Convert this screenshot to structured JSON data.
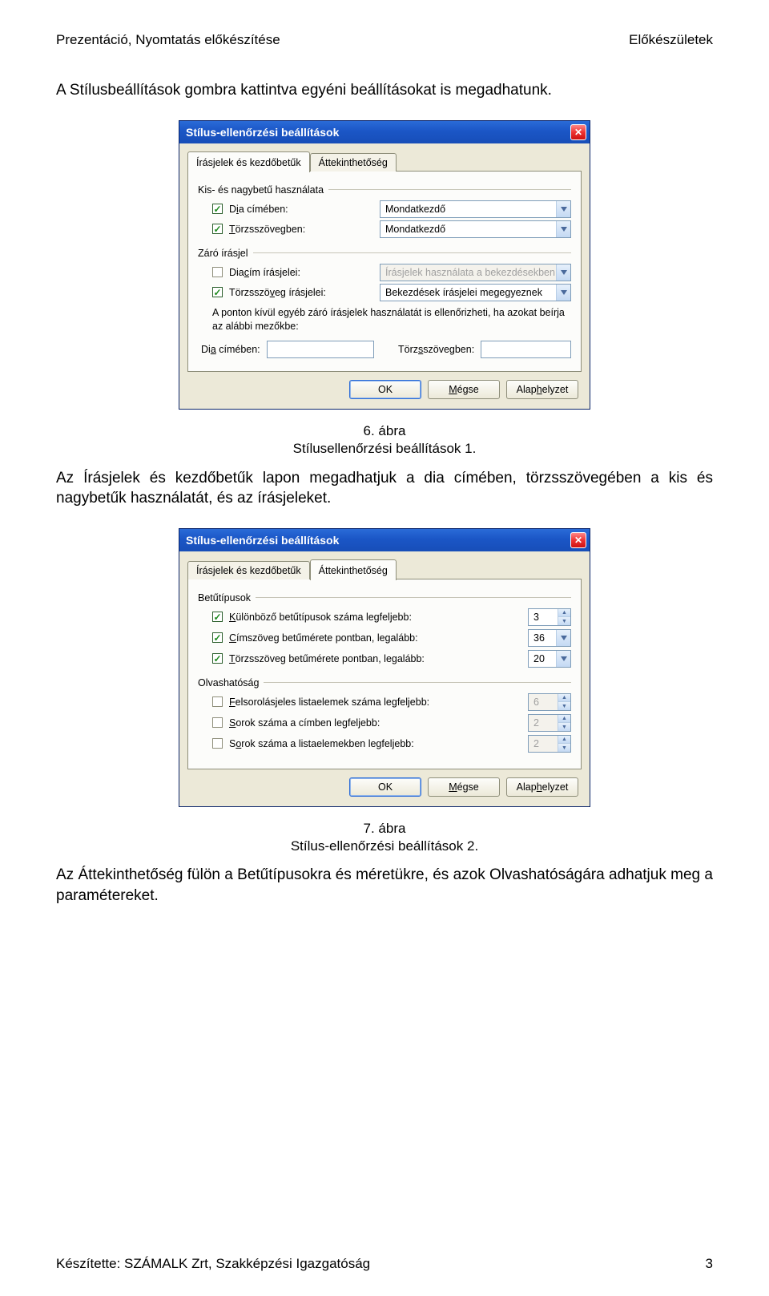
{
  "header": {
    "left": "Prezentáció, Nyomtatás előkészítése",
    "right": "Előkészületek"
  },
  "intro": "A Stílusbeállítások gombra kattintva egyéni beállításokat is megadhatunk.",
  "caption1a": "6. ábra",
  "caption1b": "Stílusellenőrzési beállítások 1.",
  "mid_para": "Az Írásjelek és kezdőbetűk lapon megadhatjuk a dia címében, törzsszövegében a kis és nagybetűk használatát, és az írásjeleket.",
  "caption2a": "7. ábra",
  "caption2b": "Stílus-ellenőrzési beállítások 2.",
  "end_para": "Az Áttekinthetőség fülön a Betűtípusokra és méretükre, és azok Olvashatóságára adhatjuk meg a paramétereket.",
  "footer": {
    "left": "Készítette: SZÁMALK Zrt, Szakképzési Igazgatóság",
    "right": "3"
  },
  "dlg1": {
    "title": "Stílus-ellenőrzési beállítások",
    "tab_active": "Írásjelek és kezdőbetűk",
    "tab_other": "Áttekinthetőség",
    "group1": "Kis- és nagybetű használata",
    "chk_diacim_pre": "D",
    "chk_diacim_ul": "i",
    "chk_diacim_post": "a címében:",
    "chk_torzs_pre": "",
    "chk_torzs_ul": "T",
    "chk_torzs_post": "örzsszövegben:",
    "dd1": "Mondatkezdő",
    "dd2": "Mondatkezdő",
    "group2": "Záró írásjel",
    "chk_diacimiras_pre": "Dia",
    "chk_diacimiras_ul": "c",
    "chk_diacimiras_post": "ím írásjelei:",
    "chk_torzsiras_pre": "Törzsszö",
    "chk_torzsiras_ul": "v",
    "chk_torzsiras_post": "eg írásjelei:",
    "dd3": "Írásjelek használata a bekezdésekben",
    "dd4": "Bekezdések írásjelei megegyeznek",
    "note": "A ponton kívül egyéb záró írásjelek használatát is ellenőrizheti, ha azokat beírja az alábbi mezőkbe:",
    "lbl_diacimeben_pre": "Di",
    "lbl_diacimeben_ul": "a",
    "lbl_diacimeben_post": " címében:",
    "lbl_torzsszov_pre": "Törz",
    "lbl_torzsszov_ul": "s",
    "lbl_torzsszov_post": "szövegben:",
    "btn_ok": "OK",
    "btn_cancel_pre": "",
    "btn_cancel_ul": "M",
    "btn_cancel_post": "égse",
    "btn_reset_pre": "Alap",
    "btn_reset_ul": "h",
    "btn_reset_post": "elyzet"
  },
  "dlg2": {
    "title": "Stílus-ellenőrzési beállítások",
    "tab_other": "Írásjelek és kezdőbetűk",
    "tab_active": "Áttekinthetőség",
    "group1": "Betűtípusok",
    "r1_pre": "",
    "r1_ul": "K",
    "r1_post": "ülönböző betűtípusok száma legfeljebb:",
    "r2_pre": "",
    "r2_ul": "C",
    "r2_post": "ímszöveg betűmérete pontban, legalább:",
    "r3_pre": "",
    "r3_ul": "T",
    "r3_post": "örzsszöveg betűmérete pontban, legalább:",
    "v1": "3",
    "v2": "36",
    "v3": "20",
    "group2": "Olvashatóság",
    "r4_pre": "",
    "r4_ul": "F",
    "r4_post": "elsorolásjeles listaelemek száma legfeljebb:",
    "r5_pre": "",
    "r5_ul": "S",
    "r5_post": "orok száma a címben legfeljebb:",
    "r6_pre": "S",
    "r6_ul": "o",
    "r6_post": "rok száma a listaelemekben legfeljebb:",
    "v4": "6",
    "v5": "2",
    "v6": "2",
    "btn_ok": "OK",
    "btn_cancel_pre": "",
    "btn_cancel_ul": "M",
    "btn_cancel_post": "égse",
    "btn_reset_pre": "Alap",
    "btn_reset_ul": "h",
    "btn_reset_post": "elyzet"
  }
}
